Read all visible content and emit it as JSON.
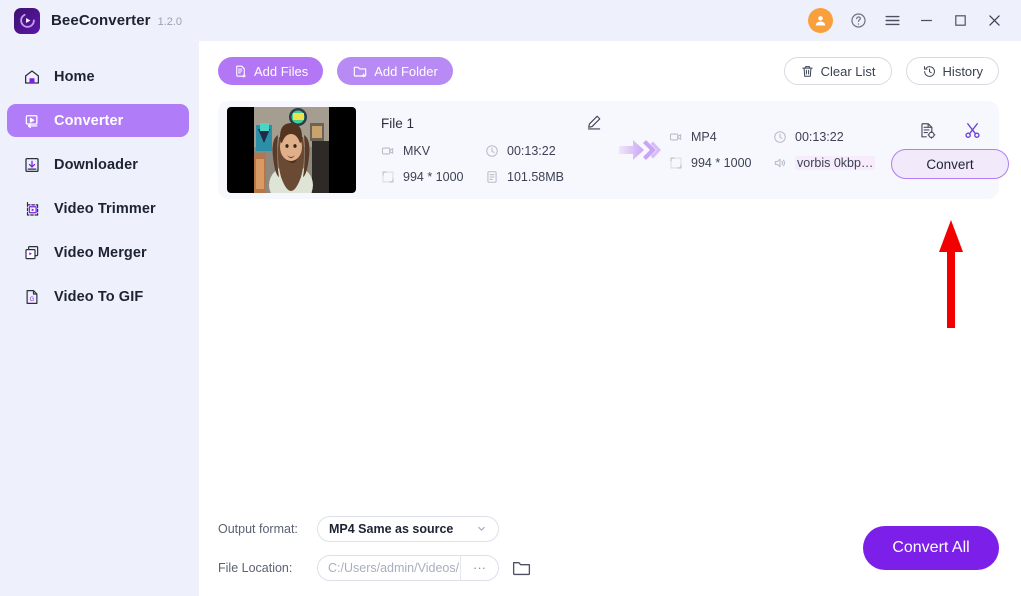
{
  "window": {
    "app_name": "BeeConverter",
    "version": "1.2.0",
    "logo_icon": "bee-play-logo-icon",
    "controls": {
      "avatar": "user-avatar-icon",
      "help": "help-circle-icon",
      "menu": "hamburger-menu-icon",
      "minimize": "minimize-icon",
      "maximize": "maximize-icon",
      "close": "close-icon"
    }
  },
  "sidebar": {
    "items": [
      {
        "label": "Home",
        "icon": "home-icon",
        "active": false
      },
      {
        "label": "Converter",
        "icon": "converter-icon",
        "active": true
      },
      {
        "label": "Downloader",
        "icon": "download-icon",
        "active": false
      },
      {
        "label": "Video Trimmer",
        "icon": "trim-icon",
        "active": false
      },
      {
        "label": "Video Merger",
        "icon": "merge-icon",
        "active": false
      },
      {
        "label": "Video To GIF",
        "icon": "gif-icon",
        "active": false
      }
    ]
  },
  "toolbar": {
    "add_files": {
      "label": "Add Files",
      "icon": "add-file-icon"
    },
    "add_folder": {
      "label": "Add Folder",
      "icon": "add-folder-icon"
    },
    "clear_list": {
      "label": "Clear List",
      "icon": "trash-icon"
    },
    "history": {
      "label": "History",
      "icon": "history-clock-icon"
    }
  },
  "file_card": {
    "name": "File 1",
    "edit_icon": "pencil-edit-icon",
    "thumbnail": "video-thumbnail-person",
    "source": {
      "format": "MKV",
      "duration": "00:13:22",
      "resolution": "994 * 1000",
      "size": "101.58MB",
      "format_icon": "video-camera-icon",
      "duration_icon": "clock-icon",
      "resolution_icon": "resolution-icon",
      "size_icon": "file-size-icon"
    },
    "arrow_icon": "convert-arrow-icon",
    "target": {
      "format": "MP4",
      "duration": "00:13:22",
      "resolution": "994 * 1000",
      "audio": "vorbis 0kbp…",
      "format_icon": "video-camera-icon",
      "duration_icon": "clock-icon",
      "resolution_icon": "resolution-icon",
      "audio_icon": "speaker-icon"
    },
    "actions": {
      "settings_icon": "file-settings-icon",
      "cut_icon": "scissors-icon",
      "convert_label": "Convert"
    }
  },
  "footer": {
    "output_format_label": "Output format:",
    "output_format_value": "MP4 Same as source",
    "output_format_chevron": "chevron-down-icon",
    "file_location_label": "File Location:",
    "file_location_value": "C:/Users/admin/Videos/",
    "browse_dots": "···",
    "folder_icon": "folder-open-icon",
    "convert_all_label": "Convert All"
  },
  "annotation": {
    "box_color": "#f20000",
    "arrow_icon": "red-up-arrow-annotation"
  },
  "colors": {
    "sidebar_bg": "#eef1fb",
    "accent_purple": "#b07cf7",
    "primary_purple": "#7c1fe8",
    "card_bg": "#f7f8fe",
    "avatar_orange": "#f9a03c"
  }
}
